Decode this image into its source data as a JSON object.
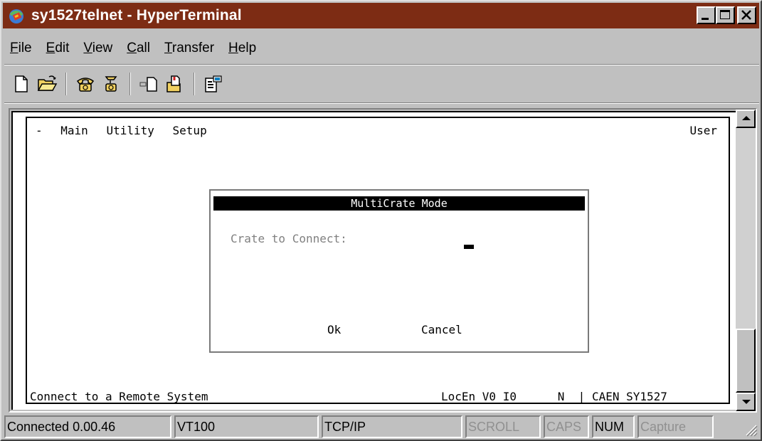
{
  "window": {
    "title": "sy1527telnet - HyperTerminal",
    "titlebar_color": "#7d2c14"
  },
  "menubar": {
    "items": [
      {
        "key": "F",
        "rest": "ile"
      },
      {
        "key": "E",
        "rest": "dit"
      },
      {
        "key": "V",
        "rest": "iew"
      },
      {
        "key": "C",
        "rest": "all"
      },
      {
        "key": "T",
        "rest": "ransfer"
      },
      {
        "key": "H",
        "rest": "elp"
      }
    ]
  },
  "toolbar": {
    "icons": [
      "new-document-icon",
      "open-folder-icon",
      "phone-connect-icon",
      "phone-disconnect-icon",
      "send-file-icon",
      "receive-file-icon",
      "properties-icon"
    ]
  },
  "terminal": {
    "menu": {
      "dash": "-",
      "main": "Main",
      "utility": "Utility",
      "setup": "Setup"
    },
    "user": "User",
    "dialog": {
      "title": "MultiCrate Mode",
      "label": "Crate to Connect:",
      "ok": "Ok",
      "cancel": "Cancel"
    },
    "bottom": {
      "left": "Connect to a Remote System",
      "locen": "LocEn V0 I0",
      "n": "N",
      "sep": "|",
      "system": "CAEN SY1527"
    }
  },
  "statusbar": {
    "connected": "Connected 0.00.46",
    "emulation": "VT100",
    "protocol": "TCP/IP",
    "scroll": "SCROLL",
    "caps": "CAPS",
    "num": "NUM",
    "capture": "Capture"
  }
}
